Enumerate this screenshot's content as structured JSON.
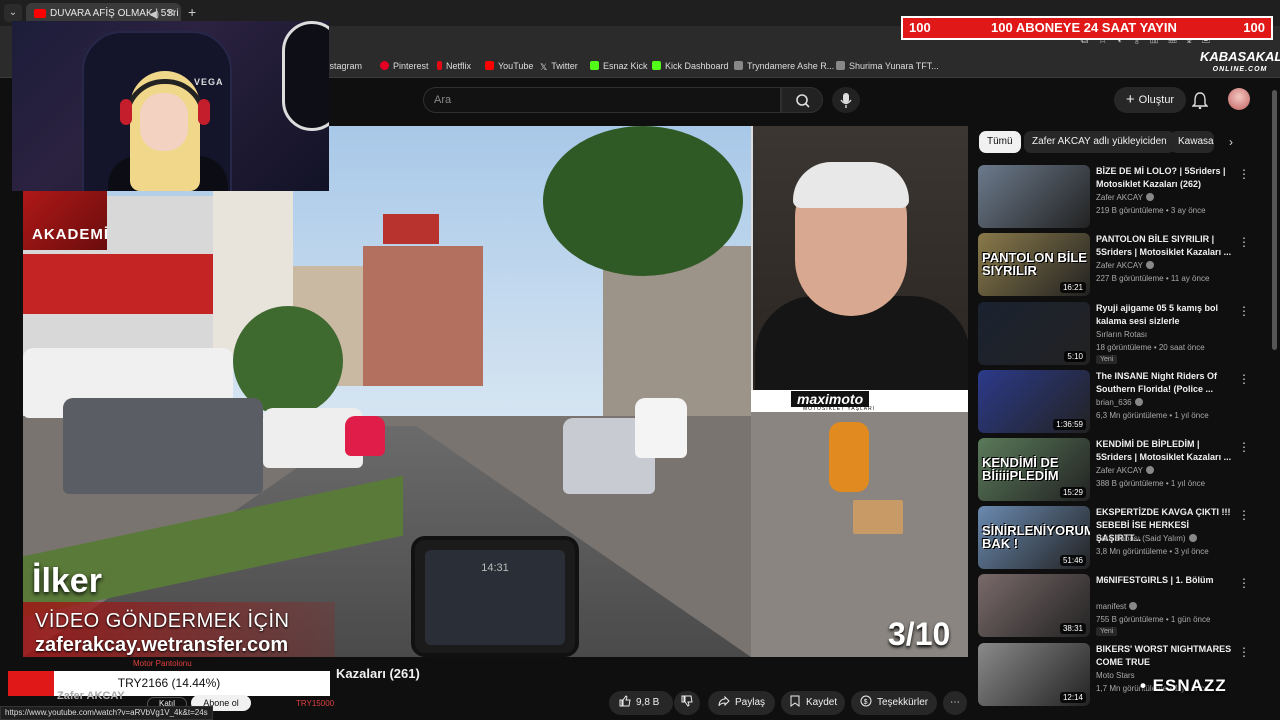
{
  "browser": {
    "tab_title": "DUVARA AFİŞ OLMAK | 5Sri",
    "bookmarks": [
      "Instagram",
      "Pinterest",
      "Netflix",
      "YouTube",
      "Twitter",
      "Esnaz Kick",
      "Kick Dashboard",
      "Tryndamere Ashe R...",
      "Shurima Yunara TFT..."
    ],
    "status_url": "https://www.youtube.com/watch?v=aRVbVg1V_4k&t=24s"
  },
  "overlay": {
    "banner_left": "100",
    "banner_center": "100 ABONEYE 24 SAAT YAYIN",
    "banner_right": "100",
    "watermark_main": "KABASAKAL",
    "watermark_sub": "ONLINE.COM",
    "webcam_chair_label": "VEGA",
    "donation_text": "TRY2166 (14.44%)",
    "motor_label": "Motor Pantolonu",
    "try_right": "TRY15000",
    "esnazz": "• ESNAZZ"
  },
  "masthead": {
    "search_placeholder": "Ara",
    "create_label": "Oluştur"
  },
  "player": {
    "akademi": "AKADEMİ",
    "name_overlay": "İlker",
    "cta_line1": "VİDEO GÖNDERMEK İÇİN",
    "cta_line2": "zaferakcay.wetransfer.com",
    "counter": "3/10",
    "pip_logo": "maximoto",
    "pip_logo_sub": "MOTOSİKLET YAŞLARI",
    "dash_text": "14:31"
  },
  "video": {
    "title_visible": "Kazaları (261)",
    "channel": "Zafer AKCAY",
    "join_label": "Katıl",
    "subscribe_label": "Abone ol",
    "likes": "9,8 B",
    "share_label": "Paylaş",
    "save_label": "Kaydet",
    "thanks_label": "Teşekkürler"
  },
  "sidebar": {
    "chips": [
      "Tümü",
      "Zafer AKCAY adlı yükleyiciden",
      "Kawasa"
    ],
    "recommendations": [
      {
        "title": "BİZE DE Mİ LOLO? | 5Sriders | Motosiklet Kazaları (262)",
        "channel": "Zafer AKCAY",
        "verified": true,
        "views": "219 B görüntüleme",
        "age": "3 ay önce",
        "duration": "",
        "thumb_text": "",
        "new": false,
        "thumb_color": "#6c7a8c"
      },
      {
        "title": "PANTOLON BİLE SIYRILIR | 5Sriders | Motosiklet Kazaları ...",
        "channel": "Zafer AKCAY",
        "verified": true,
        "views": "227 B görüntüleme",
        "age": "11 ay önce",
        "duration": "16:21",
        "thumb_text": "PANTOLON BİLE SIYRILIR",
        "new": false,
        "thumb_color": "#8a7a4a"
      },
      {
        "title": "Ryuji ajigame 05 5 kamış bol kalama sesi sizlerle",
        "channel": "Sırların Rotası",
        "verified": false,
        "views": "18 görüntüleme",
        "age": "20 saat önce",
        "duration": "5:10",
        "thumb_text": "",
        "new": true,
        "thumb_color": "#1a2230"
      },
      {
        "title": "The INSANE Night Riders Of Southern Florida! (Police ...",
        "channel": "brian_636",
        "verified": true,
        "views": "6,3 Mn görüntüleme",
        "age": "1 yıl önce",
        "duration": "1:36:59",
        "thumb_text": "",
        "new": false,
        "thumb_color": "#2c3a8a"
      },
      {
        "title": "KENDİMİ DE BİPLEDİM | 5Sriders | Motosiklet Kazaları ...",
        "channel": "Zafer AKCAY",
        "verified": true,
        "views": "388 B görüntüleme",
        "age": "1 yıl önce",
        "duration": "15:29",
        "thumb_text": "KENDİMİ DE BİiiiiPLEDİM",
        "new": false,
        "thumb_color": "#5a7a5a"
      },
      {
        "title": "EKSPERTİZDE KAVGA ÇIKTI !!! SEBEBİ İSE HERKESİ ŞAŞIRTT...",
        "channel": "Para Babası (Said Yalım)",
        "verified": true,
        "views": "3,8 Mn görüntüleme",
        "age": "3 yıl önce",
        "duration": "51:46",
        "thumb_text": "SİNİRLENİYORUM BAK !",
        "new": false,
        "thumb_color": "#6a8ab0"
      },
      {
        "title": "M6NIFESTGIRLS | 1. Bölüm",
        "channel": "manifest",
        "verified": true,
        "views": "755 B görüntüleme",
        "age": "1 gün önce",
        "duration": "38:31",
        "thumb_text": "",
        "new": true,
        "thumb_color": "#7a6a6a"
      },
      {
        "title": "BIKERS' WORST NIGHTMARES COME TRUE",
        "channel": "Moto Stars",
        "verified": false,
        "views": "1,7 Mn görüntüleme",
        "age": "1 yıl önce",
        "duration": "12:14",
        "thumb_text": "",
        "new": false,
        "thumb_color": "#8a8a8a"
      }
    ]
  }
}
